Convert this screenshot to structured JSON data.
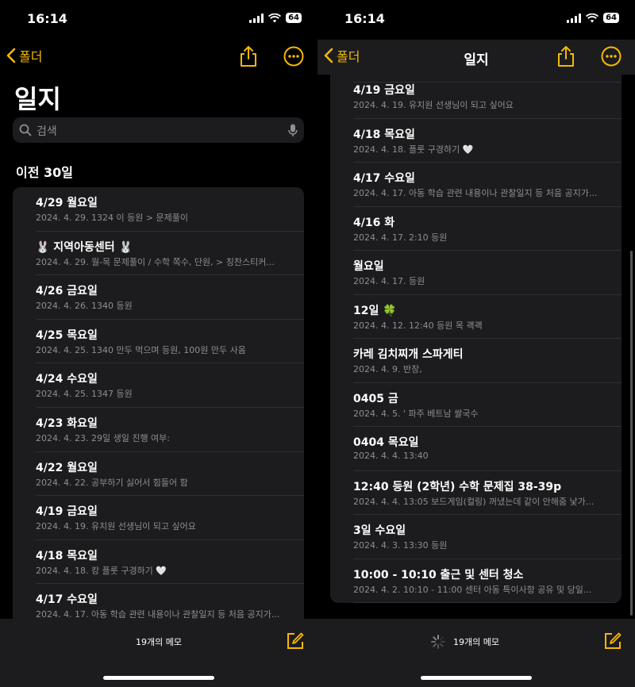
{
  "status": {
    "time": "16:14",
    "battery": "64"
  },
  "left": {
    "back_label": "폴더",
    "title": "일지",
    "search_placeholder": "검색",
    "section": "이전 30일",
    "notes": [
      {
        "title": "4/29 월요일",
        "meta": "2024. 4. 29.  1324       이 등원 > 문제풀이"
      },
      {
        "title": "🐰 지역아동센터 🐰",
        "meta": "2024. 4. 29.  월-목 문제풀이 / 수학 쪽수, 단원, > 칭찬스티커..."
      },
      {
        "title": "4/26 금요일",
        "meta": "2024. 4. 26.  1340            등원"
      },
      {
        "title": "4/25 목요일",
        "meta": "2024. 4. 25.  1340          만두 먹으며 등원, 100원 만두 사옴"
      },
      {
        "title": "4/24 수요일",
        "meta": "2024. 4. 25.  1347                등원"
      },
      {
        "title": "4/23 화요일",
        "meta": "2024. 4. 23.  29일 생일 진행 여부:"
      },
      {
        "title": "4/22 월요일",
        "meta": "2024. 4. 22.           공부하기 싫어서 힘들어 함"
      },
      {
        "title": "4/19 금요일",
        "meta": "2024. 4. 19.          유치원 선생님이 되고 싶어요"
      },
      {
        "title": "4/18 목요일",
        "meta": "2024. 4. 18.              캉 플룻 구경하기 🤍"
      },
      {
        "title": "4/17 수요일",
        "meta": "2024. 4. 17.  아동 학습 관련 내용이나 관찰일지 등 처음 공지가..."
      }
    ],
    "count": "19개의 메모"
  },
  "right": {
    "back_label": "폴더",
    "title": "일지",
    "notes": [
      {
        "title": "4/19 금요일",
        "meta": "2024. 4. 19.          유치원 선생님이 되고 싶어요"
      },
      {
        "title": "4/18 목요일",
        "meta": "2024. 4. 18.                        플룻 구경하기 🤍"
      },
      {
        "title": "4/17 수요일",
        "meta": "2024. 4. 17.  아동 학습 관련 내용이나 관찰일지 등 처음 공지가..."
      },
      {
        "title": "4/16 화",
        "meta": "2024. 4. 17.  2:10                 등원"
      },
      {
        "title": "월요일",
        "meta": "2024. 4. 17.                        등원"
      },
      {
        "title": "12일 🍀",
        "meta": "2024. 4. 12.  12:40              등원 목 괙괙"
      },
      {
        "title": "카레 김치찌개 스파게티",
        "meta": "2024. 4. 9.              반장,"
      },
      {
        "title": "0405 금",
        "meta": "2024. 4. 5.  '        파주 베트남 쌀국수"
      },
      {
        "title": "0404 목요일",
        "meta": "2024. 4. 4.  13:40"
      },
      {
        "title": "12:40       등원 (2학년) 수학 문제집 38-39p",
        "meta": "2024. 4. 4.  13:05 보드게임(컬링) 꺼냈는데 같이 안해줌 낯가..."
      },
      {
        "title": "3일 수요일",
        "meta": "2024. 4. 3.  13:30            등원"
      },
      {
        "title": "10:00 - 10:10 출근 및 센터 청소",
        "meta": "2024. 4. 2.  10:10 - 11:00 센터 아동 특이사항 공유 및 당일..."
      }
    ],
    "count": "19개의 메모"
  }
}
